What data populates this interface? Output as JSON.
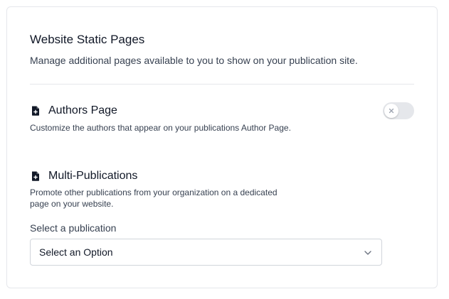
{
  "section": {
    "title": "Website Static Pages",
    "subtitle": "Manage additional pages available to you to show on your publication site."
  },
  "authors": {
    "icon": "file-plus-icon",
    "label": "Authors Page",
    "description": "Customize the authors that appear on your publications Author Page.",
    "enabled": false
  },
  "multi": {
    "icon": "file-plus-icon",
    "label": "Multi-Publications",
    "description_line1": "Promote other publications from your organization on a dedicated",
    "description_line2": "page on your website."
  },
  "select": {
    "label": "Select a publication",
    "value": "Select an Option"
  },
  "colors": {
    "toggle_off": "#e5e7eb",
    "border": "#e5e7eb",
    "text": "#111827"
  }
}
